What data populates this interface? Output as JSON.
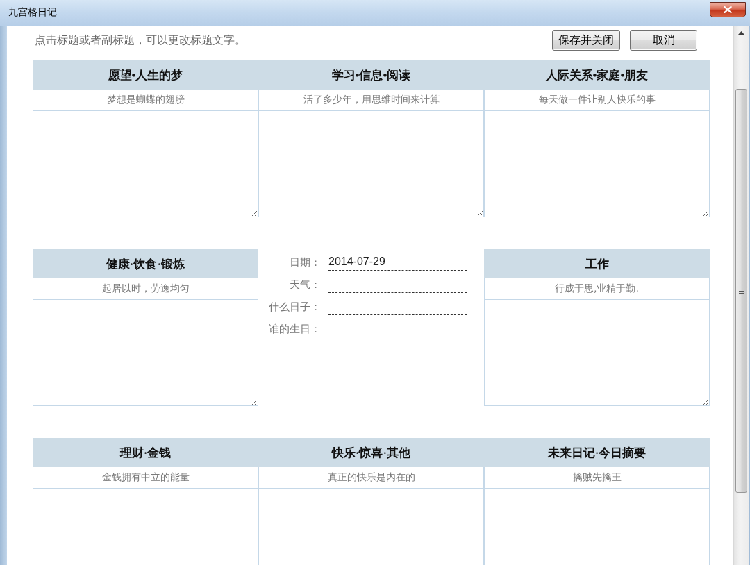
{
  "window": {
    "title": "九宫格日记"
  },
  "hint": "点击标题或者副标题，可以更改标题文字。",
  "buttons": [
    {
      "label": "保存并关闭"
    },
    {
      "label": "取消"
    }
  ],
  "grid": [
    [
      {
        "kind": "note",
        "title": "愿望•人生的梦",
        "subtitle": "梦想是蝴蝶的翅膀"
      },
      {
        "kind": "note",
        "title": "学习•信息•阅读",
        "subtitle": "活了多少年，用思维时间来计算"
      },
      {
        "kind": "note",
        "title": "人际关系•家庭•朋友",
        "subtitle": "每天做一件让别人快乐的事"
      }
    ],
    [
      {
        "kind": "note",
        "title": "健康·饮食·锻炼",
        "subtitle": "起居以时，劳逸均匀"
      },
      {
        "kind": "info",
        "fields": [
          {
            "label": "日期：",
            "value": "2014-07-29"
          },
          {
            "label": "天气："
          },
          {
            "label": "什么日子："
          },
          {
            "label": "谁的生日："
          }
        ]
      },
      {
        "kind": "note",
        "title": "工作",
        "subtitle": "行成于思,业精于勤."
      }
    ],
    [
      {
        "kind": "note",
        "title": "理财·金钱",
        "subtitle": "金钱拥有中立的能量"
      },
      {
        "kind": "note",
        "title": "快乐·惊喜·其他",
        "subtitle": "真正的快乐是内在的"
      },
      {
        "kind": "note",
        "title": "未来日记·今日摘要",
        "subtitle": "擒贼先擒王"
      }
    ]
  ]
}
